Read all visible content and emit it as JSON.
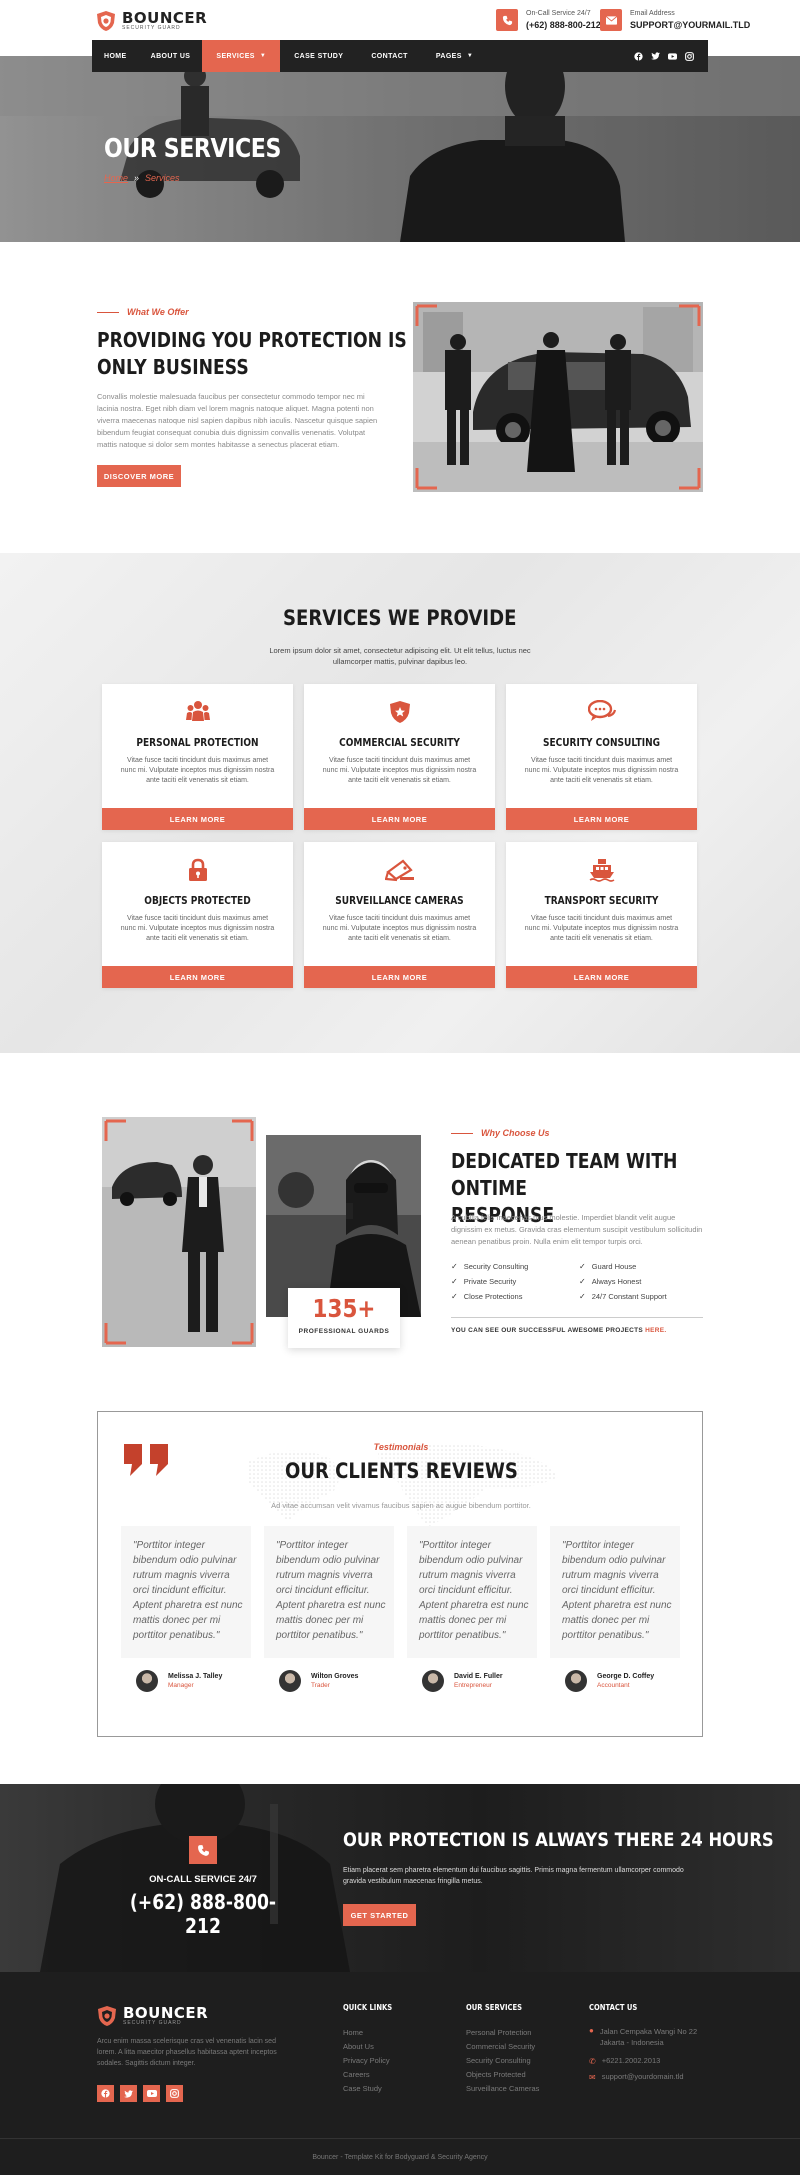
{
  "header": {
    "logo": {
      "name": "BOUNCER",
      "tagline": "SECURITY GUARD"
    },
    "call": {
      "label": "On-Call Service 24/7",
      "value": "(+62) 888-800-212"
    },
    "email": {
      "label": "Email Address",
      "value": "SUPPORT@YOURMAIL.TLD"
    }
  },
  "nav": {
    "items": [
      "HOME",
      "ABOUT US",
      "SERVICES",
      "CASE STUDY",
      "CONTACT",
      "PAGES"
    ],
    "active": "SERVICES",
    "socials": [
      "facebook-icon",
      "twitter-icon",
      "youtube-icon",
      "instagram-icon"
    ]
  },
  "hero": {
    "title": "OUR SERVICES",
    "crumb_home": "Home",
    "crumb_sep": "»",
    "crumb_current": "Services"
  },
  "about": {
    "eyebrow": "What We Offer",
    "title_line1": "PROVIDING YOU PROTECTION IS OUR",
    "title_line2": "ONLY BUSINESS",
    "text": "Convallis molestie malesuada faucibus per consectetur commodo tempor nec mi lacinia nostra. Eget nibh diam vel lorem magnis natoque aliquet. Magna potenti non viverra maecenas natoque nisl sapien dapibus nibh iaculis. Nascetur quisque sapien bibendum feugiat consequat conubia duis dignissim convallis venenatis. Volutpat mattis natoque si dolor sem montes habitasse a senectus placerat etiam.",
    "button": "DISCOVER MORE"
  },
  "services": {
    "title": "SERVICES WE PROVIDE",
    "subtitle_line1": "Lorem ipsum dolor sit amet, consectetur adipiscing elit. Ut elit tellus, luctus nec",
    "subtitle_line2": "ullamcorper mattis, pulvinar dapibus leo.",
    "cards": [
      {
        "title": "PERSONAL PROTECTION",
        "icon": "people-icon",
        "text": "Vitae fusce taciti tincidunt duis maximus amet nunc mi. Vulputate inceptos mus dignissim nostra ante taciti elit venenatis sit etiam.",
        "button": "LEARN MORE"
      },
      {
        "title": "COMMERCIAL SECURITY",
        "icon": "shield-star-icon",
        "text": "Vitae fusce taciti tincidunt duis maximus amet nunc mi. Vulputate inceptos mus dignissim nostra ante taciti elit venenatis sit etiam.",
        "button": "LEARN MORE"
      },
      {
        "title": "SECURITY CONSULTING",
        "icon": "chat-icon",
        "text": "Vitae fusce taciti tincidunt duis maximus amet nunc mi. Vulputate inceptos mus dignissim nostra ante taciti elit venenatis sit etiam.",
        "button": "LEARN MORE"
      },
      {
        "title": "OBJECTS PROTECTED",
        "icon": "lock-icon",
        "text": "Vitae fusce taciti tincidunt duis maximus amet nunc mi. Vulputate inceptos mus dignissim nostra ante taciti elit venenatis sit etiam.",
        "button": "LEARN MORE"
      },
      {
        "title": "SURVEILLANCE CAMERAS",
        "icon": "camera-icon",
        "text": "Vitae fusce taciti tincidunt duis maximus amet nunc mi. Vulputate inceptos mus dignissim nostra ante taciti elit venenatis sit etiam.",
        "button": "LEARN MORE"
      },
      {
        "title": "TRANSPORT SECURITY",
        "icon": "ship-icon",
        "text": "Vitae fusce taciti tincidunt duis maximus amet nunc mi. Vulputate inceptos mus dignissim nostra ante taciti elit venenatis sit etiam.",
        "button": "LEARN MORE"
      }
    ]
  },
  "why": {
    "eyebrow": "Why Choose Us",
    "title_line1": "DEDICATED TEAM WITH ONTIME",
    "title_line2": "RESPONSE",
    "text": "A cubilia felis maecenas mus molestie. Imperdiet blandit velit augue dignissim ex metus. Gravida cras elementum suscipit vestibulum sollicitudin aenean penatibus proin. Nulla enim elit tempor turpis orci.",
    "checks": [
      "Security Consulting",
      "Guard House",
      "Private Security",
      "Always Honest",
      "Close Protections",
      "24/7 Constant Support"
    ],
    "stat_value": "135+",
    "stat_label": "PROFESSIONAL GUARDS",
    "projects_text": "YOU CAN SEE OUR SUCCESSFUL AWESOME PROJECTS",
    "projects_link": "HERE."
  },
  "testimonials": {
    "eyebrow": "Testimonials",
    "title": "OUR CLIENTS REVIEWS",
    "subtitle": "Ad vitae accumsan velit vivamus faucibus sapien ac augue bibendum porttitor.",
    "quote": "\"Porttitor integer bibendum odio pulvinar rutrum magnis viverra orci tincidunt efficitur. Aptent pharetra est nunc mattis donec per mi porttitor penatibus.\"",
    "people": [
      {
        "name": "Melissa J. Talley",
        "role": "Manager"
      },
      {
        "name": "Wilton Groves",
        "role": "Trader"
      },
      {
        "name": "David E. Fuller",
        "role": "Entrepreneur"
      },
      {
        "name": "George D. Coffey",
        "role": "Accountant"
      }
    ]
  },
  "cta": {
    "label": "ON-CALL SERVICE 24/7",
    "phone": "(+62) 888-800-212",
    "title": "OUR PROTECTION IS ALWAYS THERE 24 HOURS",
    "text_line1": "Etiam placerat sem pharetra elementum dui faucibus sagittis. Primis magna fermentum ullamcorper commodo",
    "text_line2": "gravida vestibulum maecenas fringilla metus.",
    "button": "GET STARTED"
  },
  "footer": {
    "logo": {
      "name": "BOUNCER",
      "tagline": "SECURITY GUARD"
    },
    "about_text": "Arcu enim massa scelerisque cras vel venenatis lacin sed lorem. A litta maecitor phasellus habitassa aptent inceptos sodales. Sagittis dictum integer.",
    "socials": [
      "facebook-icon",
      "twitter-icon",
      "youtube-icon",
      "instagram-icon"
    ],
    "quick_links": {
      "title": "QUICK LINKS",
      "items": [
        "Home",
        "About Us",
        "Privacy Policy",
        "Careers",
        "Case Study"
      ]
    },
    "our_services": {
      "title": "OUR SERVICES",
      "items": [
        "Personal Protection",
        "Commercial Security",
        "Security Consulting",
        "Objects Protected",
        "Surveillance Cameras"
      ]
    },
    "contact": {
      "title": "CONTACT US",
      "address_line1": "Jalan Cempaka Wangi No 22",
      "address_line2": "Jakarta - Indonesia",
      "phone": "+6221.2002.2013",
      "email": "support@yourdomain.tld"
    },
    "copyright": "Bouncer - Template Kit for Bodyguard & Security Agency"
  },
  "colors": {
    "accent": "#e4664f",
    "dark": "#222222",
    "footer": "#1e1e1e"
  }
}
